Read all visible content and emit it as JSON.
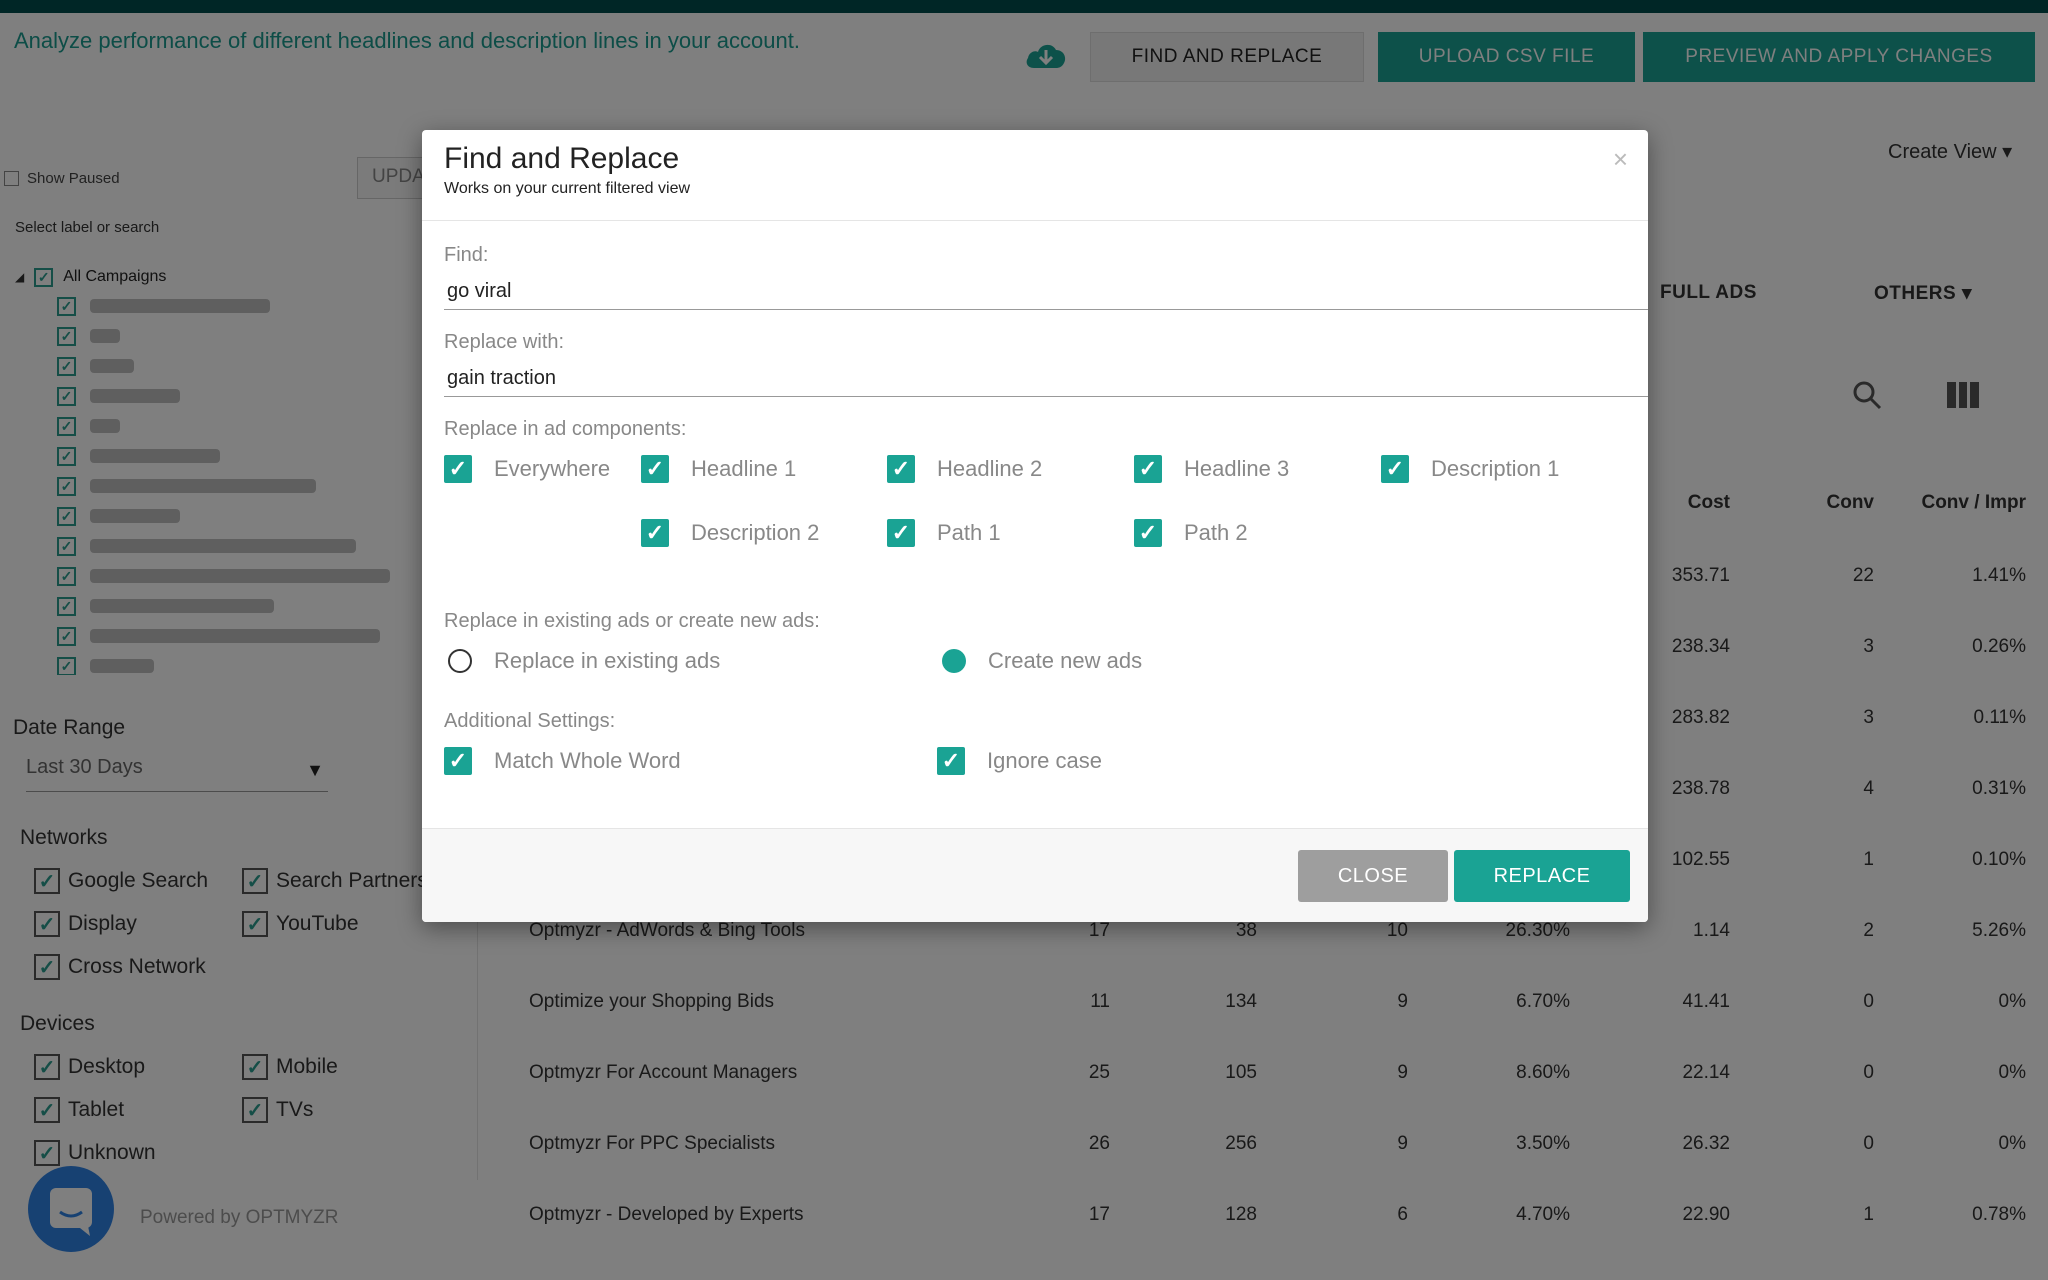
{
  "header": {
    "subtitle": "Analyze performance of different headlines and description lines in your account.",
    "find_replace_btn": "FIND AND REPLACE",
    "upload_csv_btn": "UPLOAD CSV FILE",
    "preview_apply_btn": "PREVIEW AND APPLY CHANGES"
  },
  "sidebar": {
    "show_paused": "Show Paused",
    "update_btn": "UPDA",
    "label_search": "Select label or search",
    "all_campaigns": "All Campaigns",
    "date_range_label": "Date Range",
    "date_range_value": "Last 30 Days",
    "networks_label": "Networks",
    "networks": [
      "Google Search",
      "Search Partners",
      "Display",
      "YouTube",
      "Cross Network"
    ],
    "devices_label": "Devices",
    "devices": [
      "Desktop",
      "Mobile",
      "Tablet",
      "TVs",
      "Unknown"
    ],
    "powered_by": "Powered by OPTMYZR"
  },
  "toolbar": {
    "create_view": "Create View ▾",
    "tab_full_ads": "FULL ADS",
    "tab_others": "OTHERS ▾"
  },
  "table": {
    "headers": {
      "cost": "Cost",
      "conv": "Conv",
      "conv_impr": "Conv / Impr"
    },
    "rows": [
      {
        "name": "",
        "c1": "",
        "c2": "",
        "c3": "",
        "c4": "",
        "cost": "353.71",
        "conv": "22",
        "ci": "1.41%"
      },
      {
        "name": "",
        "c1": "",
        "c2": "",
        "c3": "",
        "c4": "",
        "cost": "238.34",
        "conv": "3",
        "ci": "0.26%"
      },
      {
        "name": "",
        "c1": "",
        "c2": "",
        "c3": "",
        "c4": "",
        "cost": "283.82",
        "conv": "3",
        "ci": "0.11%"
      },
      {
        "name": "",
        "c1": "",
        "c2": "",
        "c3": "",
        "c4": "",
        "cost": "238.78",
        "conv": "4",
        "ci": "0.31%"
      },
      {
        "name": "",
        "c1": "",
        "c2": "",
        "c3": "",
        "c4": "",
        "cost": "102.55",
        "conv": "1",
        "ci": "0.10%"
      },
      {
        "name": "Optmyzr - AdWords & Bing Tools",
        "c1": "17",
        "c2": "38",
        "c3": "10",
        "c4": "26.30%",
        "cost": "1.14",
        "conv": "2",
        "ci": "5.26%"
      },
      {
        "name": "Optimize your Shopping Bids",
        "c1": "11",
        "c2": "134",
        "c3": "9",
        "c4": "6.70%",
        "cost": "41.41",
        "conv": "0",
        "ci": "0%"
      },
      {
        "name": "Optmyzr For Account Managers",
        "c1": "25",
        "c2": "105",
        "c3": "9",
        "c4": "8.60%",
        "cost": "22.14",
        "conv": "0",
        "ci": "0%"
      },
      {
        "name": "Optmyzr For PPC Specialists",
        "c1": "26",
        "c2": "256",
        "c3": "9",
        "c4": "3.50%",
        "cost": "26.32",
        "conv": "0",
        "ci": "0%"
      },
      {
        "name": "Optmyzr - Developed by Experts",
        "c1": "17",
        "c2": "128",
        "c3": "6",
        "c4": "4.70%",
        "cost": "22.90",
        "conv": "1",
        "ci": "0.78%"
      }
    ]
  },
  "modal": {
    "title": "Find and Replace",
    "subtitle": "Works on your current filtered view",
    "close_x": "×",
    "find_label": "Find:",
    "find_value": "go viral",
    "replace_label": "Replace with:",
    "replace_value": "gain traction",
    "components_label": "Replace in ad components:",
    "components": [
      "Everywhere",
      "Headline 1",
      "Headline 2",
      "Headline 3",
      "Description 1",
      "Description 2",
      "Path 1",
      "Path 2"
    ],
    "mode_label": "Replace in existing ads or create new ads:",
    "mode_existing": "Replace in existing ads",
    "mode_new": "Create new ads",
    "mode_selected": "Create new ads",
    "additional_label": "Additional Settings:",
    "match_whole_word": "Match Whole Word",
    "ignore_case": "Ignore case",
    "close_btn": "CLOSE",
    "replace_btn": "REPLACE"
  },
  "colors": {
    "accent": "#1aa394",
    "topbar": "#004d4d",
    "chat": "#2f83e4"
  }
}
